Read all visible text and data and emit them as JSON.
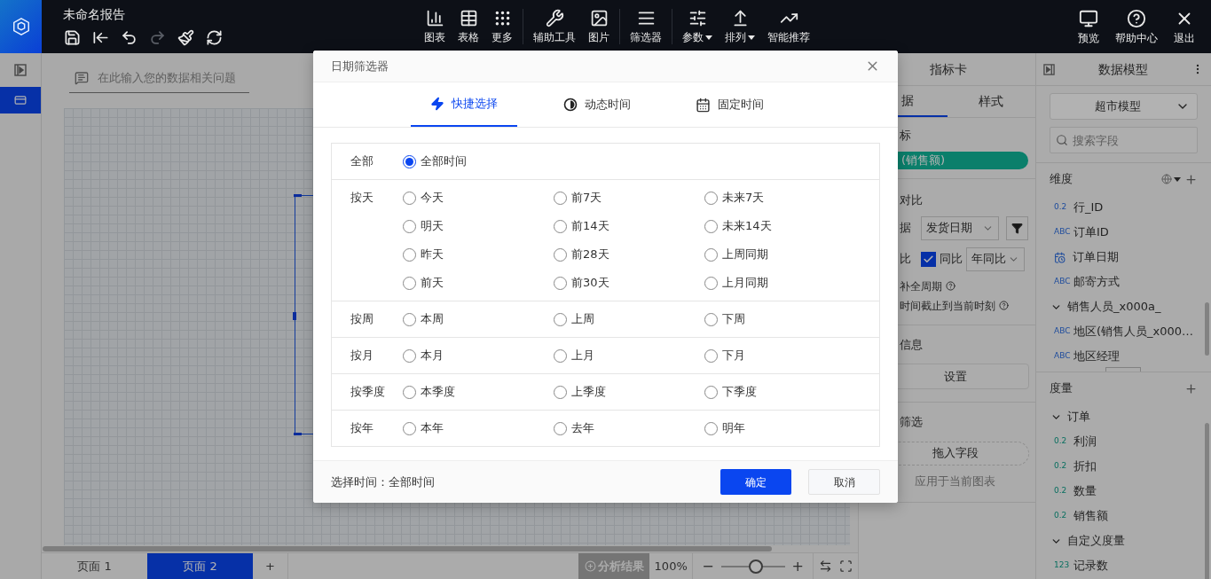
{
  "app_bar": {
    "title": "未命名报告",
    "quick_actions": [
      {
        "kind": "save",
        "disabled": false
      },
      {
        "kind": "back",
        "disabled": false
      },
      {
        "kind": "undo",
        "disabled": false
      },
      {
        "kind": "redo",
        "disabled": true
      },
      {
        "kind": "brush",
        "disabled": false
      },
      {
        "kind": "refresh",
        "disabled": false
      }
    ],
    "tool_groups": [
      [
        {
          "kind": "chart",
          "label": "图表",
          "caret": false
        },
        {
          "kind": "table",
          "label": "表格",
          "caret": false
        },
        {
          "kind": "more",
          "label": "更多",
          "caret": false
        }
      ],
      [
        {
          "kind": "tools",
          "label": "辅助工具",
          "caret": false
        },
        {
          "kind": "image",
          "label": "图片",
          "caret": false
        }
      ],
      [
        {
          "kind": "filter",
          "label": "筛选器",
          "caret": false
        }
      ],
      [
        {
          "kind": "params",
          "label": "参数",
          "caret": true
        },
        {
          "kind": "arrange",
          "label": "排列",
          "caret": true
        },
        {
          "kind": "smart",
          "label": "智能推荐",
          "caret": false
        }
      ]
    ],
    "right_actions": [
      {
        "kind": "preview",
        "label": "预览"
      },
      {
        "kind": "help",
        "label": "帮助中心"
      },
      {
        "kind": "exit",
        "label": "退出"
      }
    ]
  },
  "left_rail": [
    {
      "kind": "toggle",
      "selected": false
    },
    {
      "kind": "page",
      "selected": true
    }
  ],
  "canvas": {
    "question_placeholder": "在此输入您的数据相关问题"
  },
  "page_tabs": [
    {
      "label": "页面 1",
      "selected": false
    },
    {
      "label": "页面 2",
      "selected": true
    }
  ],
  "add_page": "+",
  "zoom_bar": {
    "analysis_label": "分析结果",
    "analysis_disabled": true,
    "percent": "100%",
    "minus": "−",
    "plus": "+",
    "level": 0.55
  },
  "props_panel": {
    "title": "指标卡",
    "tabs": [
      {
        "label": "据",
        "selected": true
      },
      {
        "label": "样式",
        "selected": false
      }
    ],
    "indicator_label": "标",
    "indicator_pill": "(销售额)",
    "compare_title": "对比",
    "date_label": "据",
    "date_field": "发货日期",
    "compare_label": "比",
    "yoy_checked": true,
    "yoy_label": "同比",
    "yoy_mode": "年同比",
    "option_fill": "补全周期",
    "option_cutoff": "时间截止到当前时刻",
    "info_title": "信息",
    "settings_button": "设置",
    "filter_title": "筛选",
    "drop_field": "拖入字段",
    "apply_label": "应用于当前图表"
  },
  "data_panel": {
    "title": "数据模型",
    "model": "超市模型",
    "search_placeholder": "搜索字段",
    "dimensions": {
      "title": "维度",
      "items": [
        {
          "kind": "field",
          "tag": "0.2",
          "label": "行_ID"
        },
        {
          "kind": "field",
          "tag": "ABC",
          "label": "订单ID"
        },
        {
          "kind": "date",
          "label": "订单日期"
        },
        {
          "kind": "field",
          "tag": "ABC",
          "label": "邮寄方式"
        },
        {
          "kind": "group",
          "label": "销售人员_x000a_",
          "expanded": true,
          "children": [
            {
              "kind": "field",
              "tag": "ABC",
              "label": "地区(销售人员_x000…"
            },
            {
              "kind": "field",
              "tag": "ABC",
              "label": "地区经理"
            }
          ]
        }
      ]
    },
    "measures": {
      "title": "度量",
      "items": [
        {
          "kind": "group",
          "label": "订单",
          "expanded": true,
          "children": [
            {
              "kind": "field",
              "tag": "0.2",
              "label": "利润"
            },
            {
              "kind": "field",
              "tag": "0.2",
              "label": "折扣"
            },
            {
              "kind": "field",
              "tag": "0.2",
              "label": "数量"
            },
            {
              "kind": "field",
              "tag": "0.2",
              "label": "销售额"
            }
          ]
        },
        {
          "kind": "group",
          "label": "自定义度量",
          "expanded": true,
          "children": [
            {
              "kind": "field",
              "tag": "123",
              "label": "记录数"
            }
          ]
        }
      ]
    }
  },
  "dialog": {
    "title": "日期筛选器",
    "tabs": [
      {
        "kind": "quick",
        "label": "快捷选择",
        "selected": true
      },
      {
        "kind": "dynamic",
        "label": "动态时间",
        "selected": false
      },
      {
        "kind": "fixed",
        "label": "固定时间",
        "selected": false
      }
    ],
    "groups": [
      {
        "label": "全部",
        "options": [
          {
            "label": "全部时间",
            "selected": true
          }
        ]
      },
      {
        "label": "按天",
        "options": [
          {
            "label": "今天",
            "selected": false
          },
          {
            "label": "前7天",
            "selected": false
          },
          {
            "label": "未来7天",
            "selected": false
          },
          {
            "label": "明天",
            "selected": false
          },
          {
            "label": "前14天",
            "selected": false
          },
          {
            "label": "未来14天",
            "selected": false
          },
          {
            "label": "昨天",
            "selected": false
          },
          {
            "label": "前28天",
            "selected": false
          },
          {
            "label": "上周同期",
            "selected": false
          },
          {
            "label": "前天",
            "selected": false
          },
          {
            "label": "前30天",
            "selected": false
          },
          {
            "label": "上月同期",
            "selected": false
          }
        ]
      },
      {
        "label": "按周",
        "options": [
          {
            "label": "本周",
            "selected": false
          },
          {
            "label": "上周",
            "selected": false
          },
          {
            "label": "下周",
            "selected": false
          }
        ]
      },
      {
        "label": "按月",
        "options": [
          {
            "label": "本月",
            "selected": false
          },
          {
            "label": "上月",
            "selected": false
          },
          {
            "label": "下月",
            "selected": false
          }
        ]
      },
      {
        "label": "按季度",
        "options": [
          {
            "label": "本季度",
            "selected": false
          },
          {
            "label": "上季度",
            "selected": false
          },
          {
            "label": "下季度",
            "selected": false
          }
        ]
      },
      {
        "label": "按年",
        "options": [
          {
            "label": "本年",
            "selected": false
          },
          {
            "label": "去年",
            "selected": false
          },
          {
            "label": "明年",
            "selected": false
          }
        ]
      }
    ],
    "footer": {
      "selection_label": "选择时间：",
      "selection_value": "全部时间",
      "confirm": "确定",
      "cancel": "取消"
    }
  }
}
